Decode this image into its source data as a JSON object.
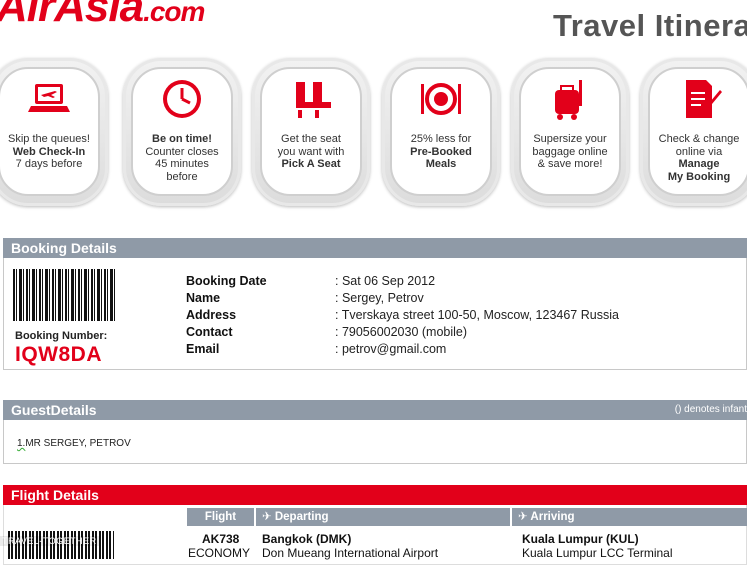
{
  "header": {
    "logo_main": "AirAsia",
    "logo_suffix": ".com",
    "title": "Travel Itinerary"
  },
  "tiles": [
    {
      "icon": "laptop-plane-icon",
      "lines": [
        "Skip the queues!",
        "Web Check-In",
        "7 days before"
      ]
    },
    {
      "icon": "clock-icon",
      "lines": [
        "Be on time!",
        "Counter closes",
        "45 minutes",
        "before"
      ]
    },
    {
      "icon": "seat-icon",
      "lines": [
        "Get the seat",
        "you want with",
        "Pick A Seat"
      ]
    },
    {
      "icon": "meal-plate-icon",
      "lines": [
        "25% less for",
        "Pre-Booked",
        "Meals"
      ]
    },
    {
      "icon": "baggage-icon",
      "lines": [
        "Supersize your",
        "baggage online",
        "& save more!"
      ]
    },
    {
      "icon": "document-pen-icon",
      "lines": [
        "Check & change",
        "online via",
        "Manage",
        "My Booking"
      ]
    }
  ],
  "booking": {
    "section_title": "Booking Details",
    "number_label": "Booking Number:",
    "number": "IQW8DA",
    "rows": [
      {
        "label": "Booking Date",
        "value": ": Sat 06 Sep 2012"
      },
      {
        "label": "Name",
        "value": ": Sergey, Petrov"
      },
      {
        "label": "Address",
        "value": ": Tverskaya street 100-50, Moscow, 123467 Russia"
      },
      {
        "label": "Contact",
        "value": ": 79056002030 (mobile)"
      },
      {
        "label": "Email",
        "value": ": petrov@gmail.com"
      }
    ]
  },
  "guests": {
    "section_title": "GuestDetails",
    "note": "() denotes infant",
    "guest_number": "1.",
    "guest_name": "MR SERGEY, PETROV"
  },
  "flight": {
    "section_title": "Flight Details",
    "headers": {
      "flight": "Flight",
      "departing": "Departing",
      "arriving": "Arriving"
    },
    "row": {
      "flight_no": "AK738",
      "class": "ECONOMY",
      "dep_city": "Bangkok (DMK)",
      "dep_airport": "Don Mueang International Airport",
      "arr_city": "Kuala Lumpur (KUL)",
      "arr_airport": "Kuala Lumpur LCC Terminal"
    }
  },
  "watermark": "TRAVEL-TOGETHER"
}
